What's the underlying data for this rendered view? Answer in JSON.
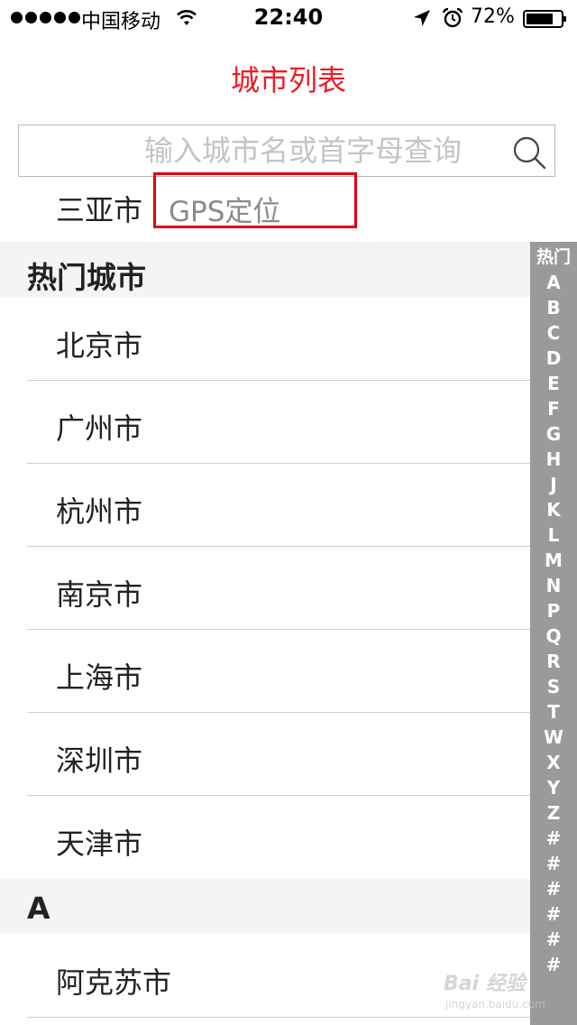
{
  "status_bar": {
    "carrier": "中国移动",
    "time": "22:40",
    "battery": "72%"
  },
  "title": "城市列表",
  "search": {
    "placeholder": "输入城市名或首字母查询",
    "value": ""
  },
  "current_location": {
    "city": "三亚市",
    "gps_label": "GPS定位"
  },
  "sections": [
    {
      "header": "热门城市",
      "items": [
        "北京市",
        "广州市",
        "杭州市",
        "南京市",
        "上海市",
        "深圳市",
        "天津市"
      ]
    },
    {
      "header": "A",
      "items": [
        "阿克苏市"
      ]
    }
  ],
  "index_bar": [
    "热门",
    "A",
    "B",
    "C",
    "D",
    "E",
    "F",
    "G",
    "H",
    "J",
    "K",
    "L",
    "M",
    "N",
    "P",
    "Q",
    "R",
    "S",
    "T",
    "W",
    "X",
    "Y",
    "Z",
    "#",
    "#",
    "#",
    "#",
    "#",
    "#"
  ],
  "watermark": {
    "top": "Bai 经验",
    "bottom": "jingyan.baidu.com"
  },
  "colors": {
    "title": "#ee1c24",
    "gps_border": "#e2000f",
    "section_bg": "#f4f4f4",
    "index_bar_bg": "#9a9a9a"
  }
}
